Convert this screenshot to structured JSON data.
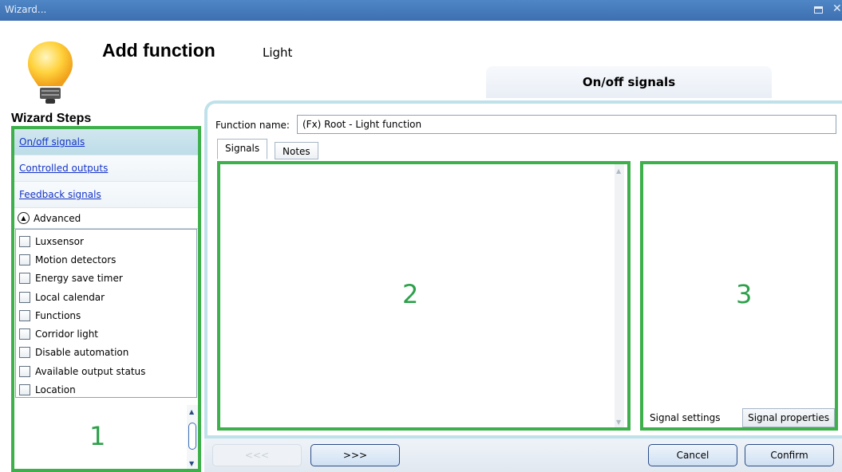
{
  "window": {
    "title": "Wizard..."
  },
  "header": {
    "heading": "Add function",
    "subheading": "Light",
    "current_step_tab": "On/off signals"
  },
  "sidebar": {
    "title": "Wizard Steps",
    "steps": [
      {
        "label": "On/off signals"
      },
      {
        "label": "Controlled outputs"
      },
      {
        "label": "Feedback signals"
      }
    ],
    "advanced_label": "Advanced",
    "options": [
      {
        "label": "Luxsensor",
        "checked": false
      },
      {
        "label": "Motion detectors",
        "checked": false
      },
      {
        "label": "Energy save timer",
        "checked": false
      },
      {
        "label": "Local calendar",
        "checked": false
      },
      {
        "label": "Functions",
        "checked": false
      },
      {
        "label": "Corridor light",
        "checked": false
      },
      {
        "label": "Disable automation",
        "checked": false
      },
      {
        "label": "Available output status",
        "checked": false
      },
      {
        "label": "Location",
        "checked": false
      }
    ],
    "annotation": "1"
  },
  "main": {
    "function_name_label": "Function name:",
    "function_name_value": "(Fx) Root - Light function",
    "tabs": [
      {
        "label": "Signals"
      },
      {
        "label": "Notes"
      }
    ],
    "signals_annotation": "2",
    "settings_annotation": "3",
    "settings_tabs": [
      {
        "label": "Signal settings"
      },
      {
        "label": "Signal properties"
      }
    ]
  },
  "footer": {
    "prev_label": "<<<",
    "next_label": ">>>",
    "cancel_label": "Cancel",
    "confirm_label": "Confirm"
  },
  "colors": {
    "annotation_green": "#3db04b",
    "titlebar_blue": "#3c6fb0"
  }
}
